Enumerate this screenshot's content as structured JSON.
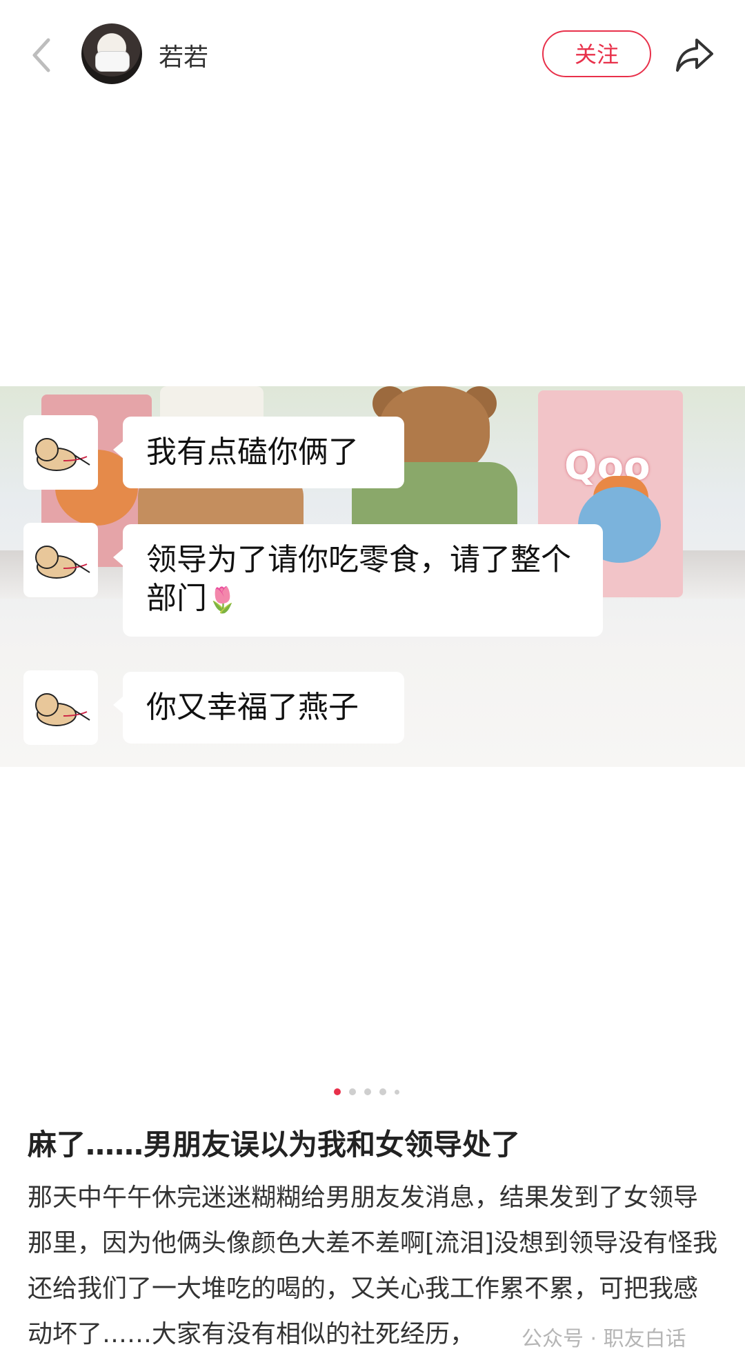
{
  "header": {
    "username": "若若",
    "follow_label": "关注"
  },
  "post_image": {
    "product_brand_text": "Qoo",
    "chat_messages": [
      {
        "text": "我有点磕你俩了"
      },
      {
        "text": "领导为了请你吃零食，请了整个部门",
        "emoji": "🌷"
      },
      {
        "text": "你又幸福了燕子"
      }
    ]
  },
  "carousel": {
    "count": 5,
    "active_index": 0,
    "active_color": "#e8304a",
    "inactive_color": "#cfcfcf"
  },
  "post": {
    "title": "麻了……男朋友误以为我和女领导处了",
    "body": "那天中午午休完迷迷糊糊给男朋友发消息，结果发到了女领导那里，因为他俩头像颜色大差不差啊[流泪]没想到领导没有怪我还给我们了一大堆吃的喝的，又关心我工作累不累，可把我感动坏了……大家有没有相似的社死经历，"
  },
  "watermark": "公众号 · 职友白话",
  "colors": {
    "accent": "#e8304a"
  },
  "icons": {
    "back": "chevron-left-icon",
    "share": "share-arrow-icon",
    "chat_avatar": "dog-icon"
  }
}
